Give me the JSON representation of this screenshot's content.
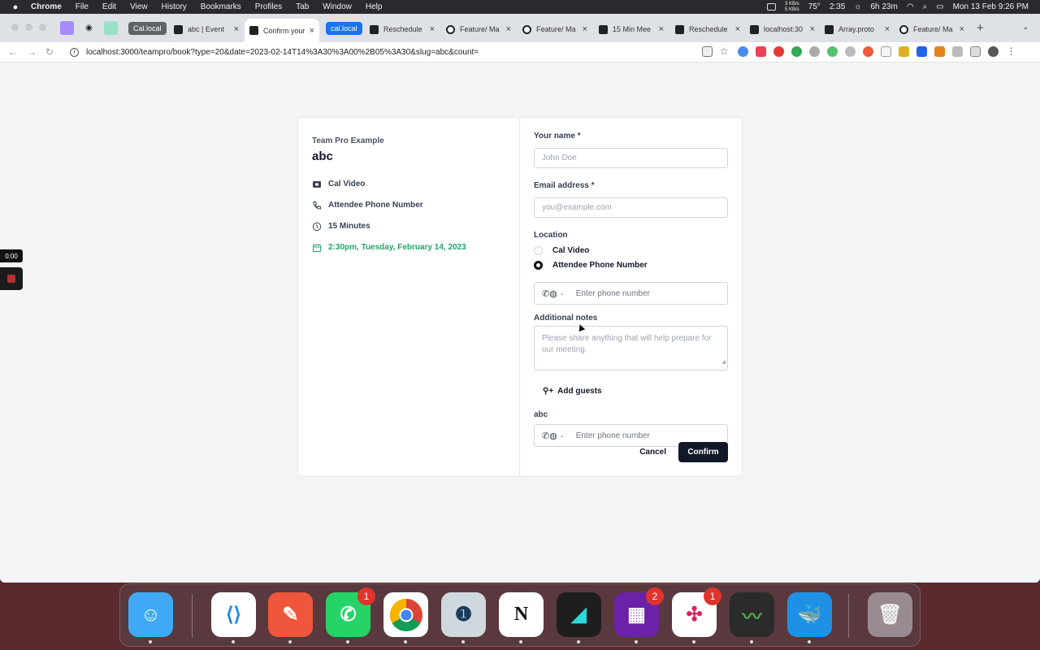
{
  "menubar": {
    "apple": "",
    "items": [
      "Chrome",
      "File",
      "Edit",
      "View",
      "History",
      "Bookmarks",
      "Profiles",
      "Tab",
      "Window",
      "Help"
    ],
    "net_up": "3 KB/s",
    "net_down": "5 KB/s",
    "temp": "75°",
    "time_remaining": "2:35",
    "battery": "6h 23m",
    "datetime": "Mon 13 Feb  9:26 PM"
  },
  "browser": {
    "tabs": [
      {
        "label": "Cal.local",
        "group": true
      },
      {
        "label": "abc | Event"
      },
      {
        "label": "Confirm your"
      },
      {
        "label": "cal.local",
        "group": true
      },
      {
        "label": "Reschedule"
      },
      {
        "label": "Feature/ Ma"
      },
      {
        "label": "Feature/ Ma"
      },
      {
        "label": "15 Min Mee"
      },
      {
        "label": "Reschedule"
      },
      {
        "label": "localhost:30"
      },
      {
        "label": "Array.proto"
      },
      {
        "label": "Feature/ Ma"
      }
    ],
    "url": "localhost:3000/teampro/book?type=20&date=2023-02-14T14%3A30%3A00%2B05%3A30&slug=abc&count="
  },
  "recording": {
    "time": "0:00"
  },
  "booking": {
    "team": "Team Pro Example",
    "event": "abc",
    "details": {
      "location": "Cal Video",
      "phone": "Attendee Phone Number",
      "duration": "15 Minutes",
      "datetime": "2:30pm, Tuesday, February 14, 2023"
    },
    "form": {
      "name_label": "Your name *",
      "name_placeholder": "John Doe",
      "email_label": "Email address *",
      "email_placeholder": "you@example.com",
      "location_label": "Location",
      "location_options": [
        "Cal Video",
        "Attendee Phone Number"
      ],
      "location_selected": "Attendee Phone Number",
      "phone_placeholder": "Enter phone number",
      "notes_label": "Additional notes",
      "notes_placeholder": "Please share anything that will help prepare for our meeting.",
      "add_guests": "Add guests",
      "abc_label": "abc",
      "abc_placeholder": "Enter phone number",
      "cancel": "Cancel",
      "confirm": "Confirm"
    }
  },
  "dock": {
    "badges": {
      "whatsapp": "1",
      "app_grid": "2",
      "slack": "1"
    }
  },
  "colors": {
    "accent": "#111827",
    "date_green": "#22a565",
    "page_bg": "#f3f4f6"
  }
}
